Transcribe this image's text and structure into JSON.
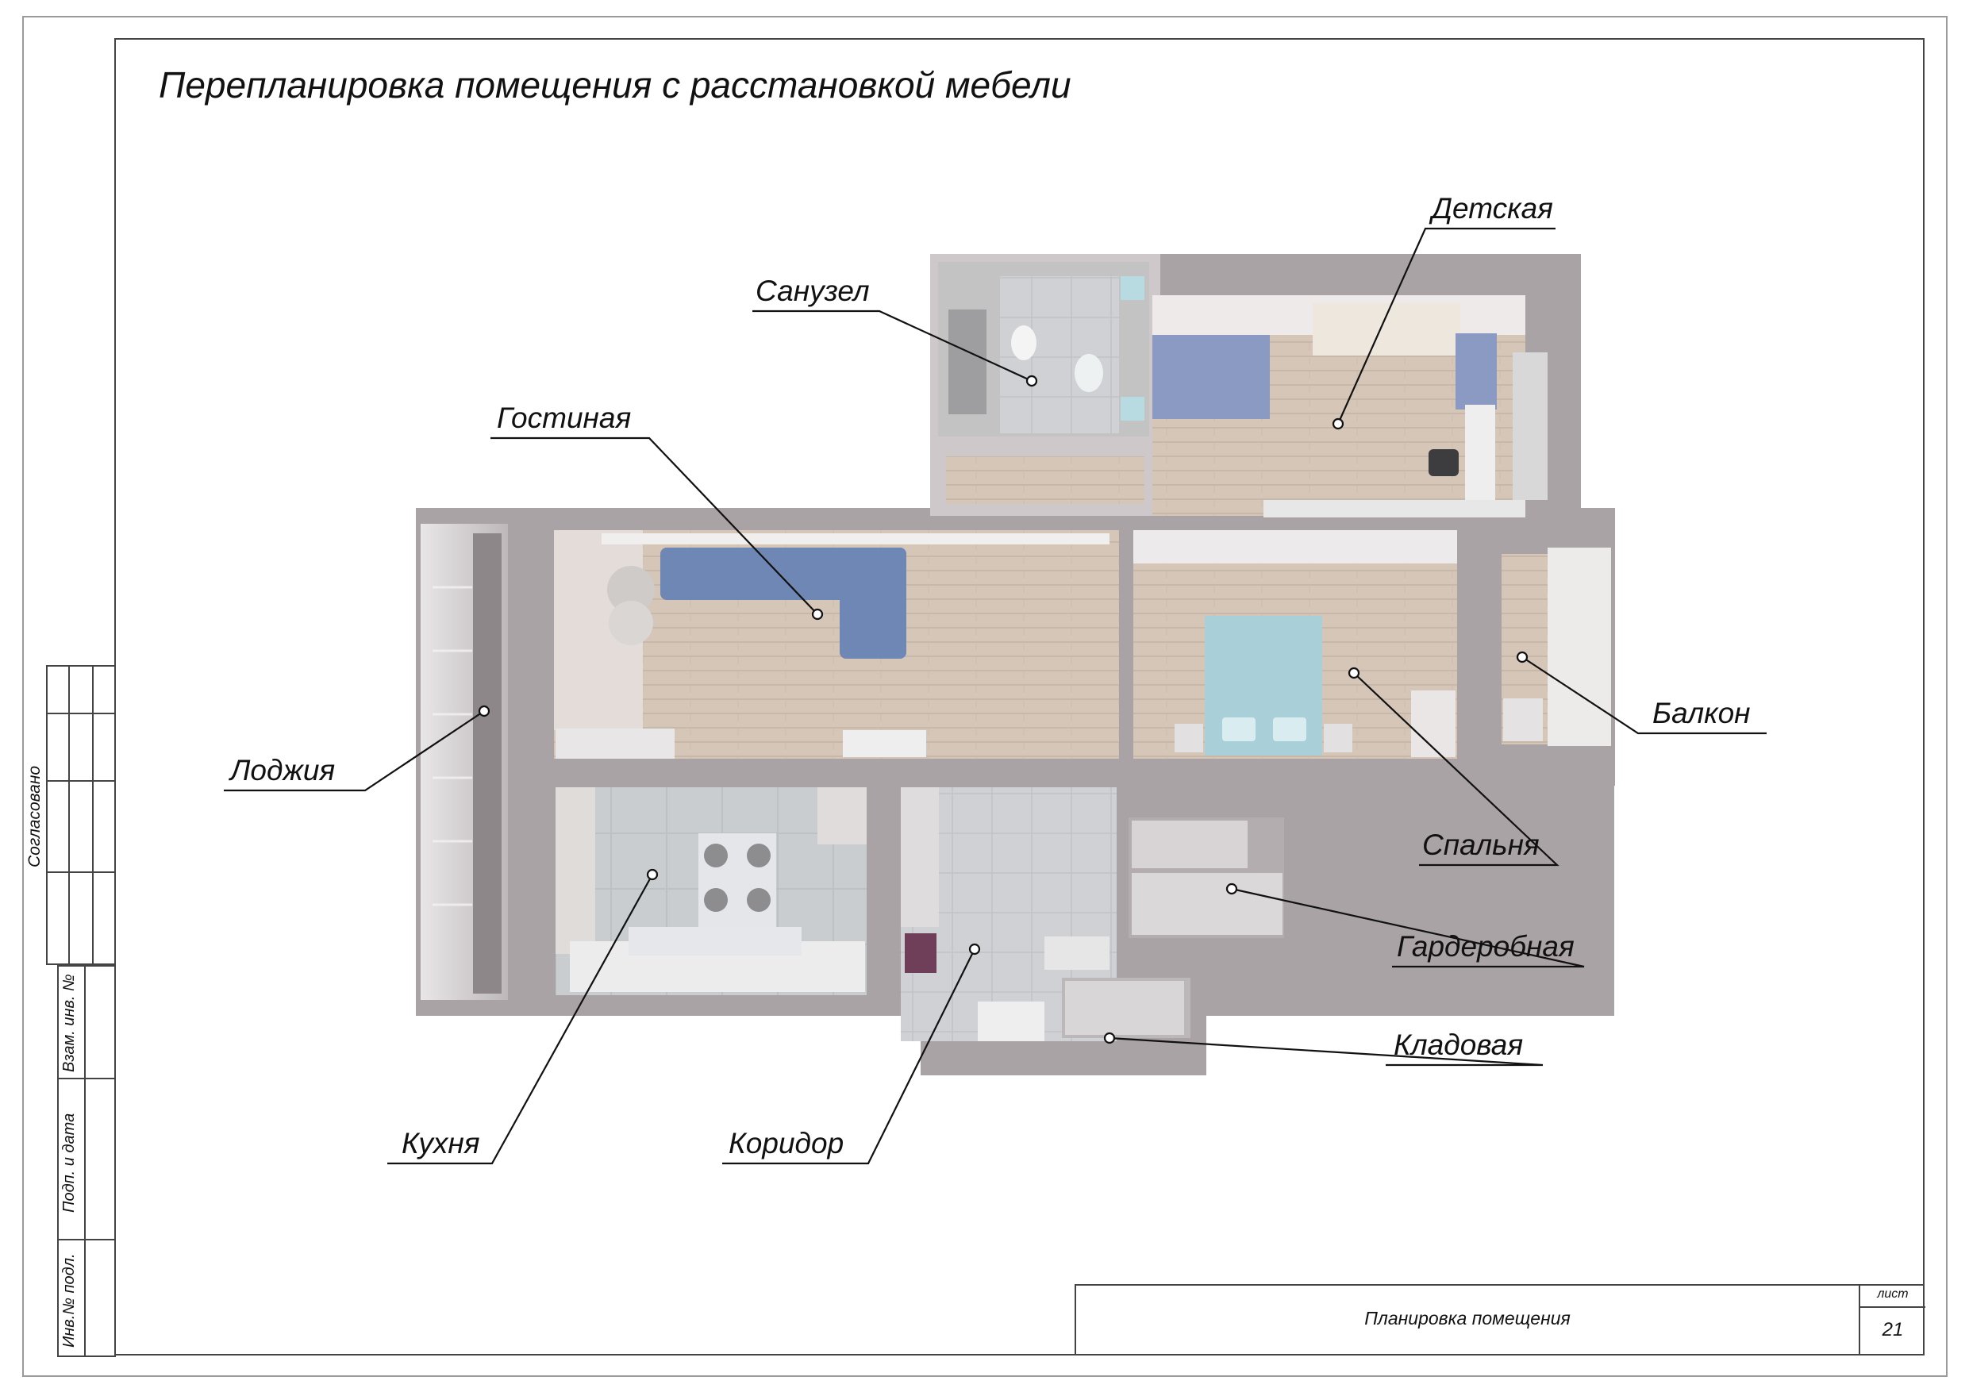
{
  "sheet": {
    "title": "Перепланировка помещения с расстановкой мебели"
  },
  "rooms": {
    "sanuzel": "Санузел",
    "detskaya": "Детская",
    "gostinaya": "Гостиная",
    "balkon": "Балкон",
    "lodzhiya": "Лоджия",
    "spalnya": "Спальня",
    "garderobnaya": "Гардеробная",
    "kladovaya": "Кладовая",
    "kukhnya": "Кухня",
    "koridor": "Коридор"
  },
  "side_stamp": {
    "soglasovano": "Согласовано",
    "vzam_inv": "Взам. инв. №",
    "podp_data": "Подп. и дата",
    "inv_podl": "Инв.№ подл."
  },
  "title_block": {
    "drawing_name": "Планировка помещения",
    "sheet_label": "лист",
    "sheet_number": "21"
  },
  "colors": {
    "wall": "#aaa3a6",
    "wall_top": "#cfc8ca",
    "floor_wood": "#d3c4b6",
    "floor_tile": "#c6cacd",
    "sofa_blue": "#6f87b5",
    "bed_teal": "#a9cfd8",
    "frame_line": "#444444"
  }
}
